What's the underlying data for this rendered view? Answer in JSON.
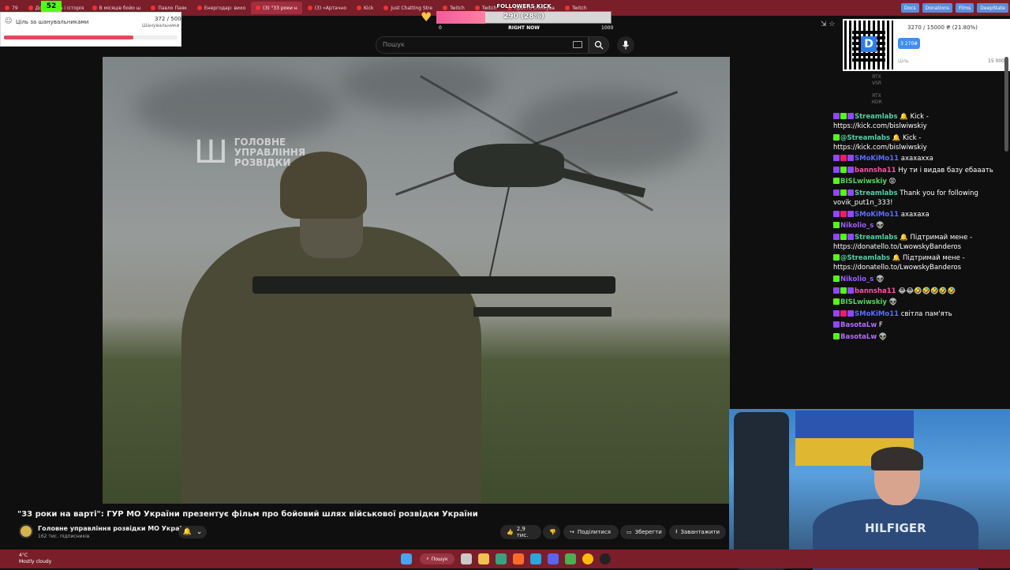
{
  "browser": {
    "tabs": [
      {
        "label": "79"
      },
      {
        "label": "Документа і історія"
      },
      {
        "label": "В місяців бойо ш"
      },
      {
        "label": "Павло Паяк"
      },
      {
        "label": "Енергодар: вихо"
      },
      {
        "label": "(3) \"33 роки н",
        "active": true
      },
      {
        "label": "(3) «Артачно"
      },
      {
        "label": "Kick"
      },
      {
        "label": "Just Chatting Stre"
      },
      {
        "label": "Twitch"
      },
      {
        "label": "Twitch"
      },
      {
        "label": "Просто спілкува"
      },
      {
        "label": "Twitch"
      }
    ],
    "bookmarks": [
      "Docs",
      "Donations",
      "Films",
      "DeepState"
    ],
    "kick_count": "52"
  },
  "youtube": {
    "search_placeholder": "Пошук",
    "video_title": "\"33 роки на варті\": ГУР МО України презентує фільм про бойовий шлях військової розвідки України",
    "channel_name": "Головне управління розвідки МО України",
    "subscribers": "162 тис. підписників",
    "likes": "2,9 тис.",
    "share_label": "Поділитися",
    "save_label": "Зберегти",
    "download_label": "Завантажити",
    "watermark_line1": "ГОЛОВНЕ",
    "watermark_line2": "УПРАВЛІННЯ",
    "watermark_line3": "РОЗВІДКИ"
  },
  "followers_widget": {
    "title": "FOLLOWERS KICK",
    "count_text": "290 (28%)",
    "min": "0",
    "right_now": "RIGHT NOW",
    "max": "1000",
    "progress": 0.28
  },
  "goal_widget": {
    "title": "Ціль за шанувальниками",
    "count": "372 / 500",
    "label": "Шанувальники",
    "progress": 0.744
  },
  "donation_widget": {
    "text": "3270 / 15000 ₴ (21.80%)",
    "pill": "3 270₴",
    "goal_label": "Ціль",
    "max": "15 000₴",
    "progress": 0.218
  },
  "overlay": {
    "rtx1": "RTX VSR",
    "rtx2": "RTX HDR"
  },
  "chat": [
    {
      "user": "Streamlabs",
      "color": "#4fd1a5",
      "badges": [
        "#9146ff",
        "#53fc18",
        "#9146ff"
      ],
      "text": "🔔 Kick - https://kick.com/bislwiwskiy"
    },
    {
      "user": "@Streamlabs",
      "color": "#4fd1a5",
      "badges": [
        "#53fc18"
      ],
      "text": "🔔 Kick - https://kick.com/bislwiwskiy"
    },
    {
      "user": "SMoKiMo11",
      "color": "#5b6dff",
      "badges": [
        "#9146ff",
        "#e91e63",
        "#9146ff"
      ],
      "text": "ахахахха"
    },
    {
      "user": "bannsha11",
      "color": "#ff4fa3",
      "badges": [
        "#9146ff",
        "#53fc18",
        "#9146ff"
      ],
      "text": "Ну ти і видав базу ебааать"
    },
    {
      "user": "BISLwiwskiy",
      "color": "#53d45b",
      "badges": [
        "#53fc18"
      ],
      "text": "😡"
    },
    {
      "user": "Streamlabs",
      "color": "#4fd1a5",
      "badges": [
        "#9146ff",
        "#53fc18",
        "#9146ff"
      ],
      "text": "Thank you for following vovik_put1n_333!"
    },
    {
      "user": "SMoKiMo11",
      "color": "#5b6dff",
      "badges": [
        "#9146ff",
        "#e91e63",
        "#9146ff"
      ],
      "text": "ахахаха"
    },
    {
      "user": "Nikolio_s",
      "color": "#9c5cff",
      "badges": [
        "#53fc18"
      ],
      "text": "👽"
    },
    {
      "user": "Streamlabs",
      "color": "#4fd1a5",
      "badges": [
        "#9146ff",
        "#53fc18",
        "#9146ff"
      ],
      "text": "🔔 Підтримай мене - https://donatello.to/LwowskyBanderos"
    },
    {
      "user": "@Streamlabs",
      "color": "#4fd1a5",
      "badges": [
        "#53fc18"
      ],
      "text": "🔔 Підтримай мене - https://donatello.to/LwowskyBanderos"
    },
    {
      "user": "Nikolio_s",
      "color": "#9c5cff",
      "badges": [
        "#53fc18"
      ],
      "text": "👽"
    },
    {
      "user": "bannsha11",
      "color": "#ff4fa3",
      "badges": [
        "#9146ff",
        "#53fc18",
        "#9146ff"
      ],
      "text": "😂😂🤣🤣🤣🤣🤣"
    },
    {
      "user": "BISLwiwskiy",
      "color": "#53d45b",
      "badges": [
        "#53fc18"
      ],
      "text": "👽"
    },
    {
      "user": "SMoKiMo11",
      "color": "#5b6dff",
      "badges": [
        "#9146ff",
        "#e91e63",
        "#9146ff"
      ],
      "text": "світла пам'ять"
    },
    {
      "user": "BasotaLw",
      "color": "#b36bff",
      "badges": [
        "#9146ff"
      ],
      "text": "F"
    },
    {
      "user": "BasotaLw",
      "color": "#b36bff",
      "badges": [
        "#53fc18"
      ],
      "text": "👽"
    }
  ],
  "taskbar": {
    "temp": "4°C",
    "weather": "Mostly cloudy",
    "search_label": "Пошук"
  },
  "webcam": {
    "shirt_text": "HILFIGER"
  },
  "colors": {
    "tabbar": "#7a1e2a",
    "youtube_bg": "#0f0f0f",
    "followers_fill": "#f25c9b"
  }
}
